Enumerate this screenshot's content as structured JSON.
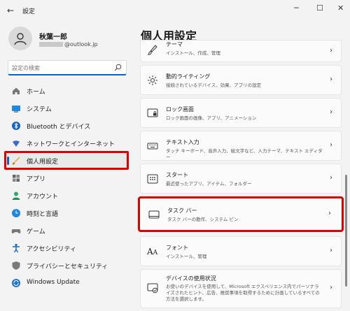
{
  "window": {
    "title": "設定",
    "back_icon": "back-arrow-icon",
    "minimize": "─",
    "maximize": "☐",
    "close": "✕"
  },
  "profile": {
    "name": "秋葉一郎",
    "email_suffix": "@outlook.jp"
  },
  "search": {
    "placeholder": "設定の検索"
  },
  "nav": [
    {
      "label": "ホーム",
      "icon": "home-icon"
    },
    {
      "label": "システム",
      "icon": "system-icon"
    },
    {
      "label": "Bluetooth とデバイス",
      "icon": "bluetooth-icon"
    },
    {
      "label": "ネットワークとインターネット",
      "icon": "network-icon"
    },
    {
      "label": "個人用設定",
      "icon": "personalization-icon",
      "active": true
    },
    {
      "label": "アプリ",
      "icon": "apps-icon"
    },
    {
      "label": "アカウント",
      "icon": "account-icon"
    },
    {
      "label": "時刻と言語",
      "icon": "time-language-icon"
    },
    {
      "label": "ゲーム",
      "icon": "gaming-icon"
    },
    {
      "label": "アクセシビリティ",
      "icon": "accessibility-icon"
    },
    {
      "label": "プライバシーとセキュリティ",
      "icon": "privacy-icon"
    },
    {
      "label": "Windows Update",
      "icon": "windows-update-icon"
    }
  ],
  "page": {
    "title": "個人用設定"
  },
  "cards": [
    {
      "title": "テーマ",
      "sub": "インストール、作成、管理",
      "icon": "theme-brush-icon"
    },
    {
      "title": "動的ライティング",
      "sub": "接続されているデバイス、効果、アプリの設定",
      "icon": "dynamic-lighting-icon"
    },
    {
      "title": "ロック画面",
      "sub": "ロック画面の画像、アプリ、アニメーション",
      "icon": "lock-screen-icon"
    },
    {
      "title": "テキスト入力",
      "sub": "タッチ キーボード、音声入力、絵文字など、入力テーマ、テキスト エディター",
      "icon": "keyboard-icon"
    },
    {
      "title": "スタート",
      "sub": "最近使ったアプリ、アイテム、フォルダー",
      "icon": "start-icon"
    },
    {
      "title": "タスク バー",
      "sub": "タスク バーの動作、システム ピン",
      "icon": "taskbar-icon",
      "selected": true
    },
    {
      "title": "フォント",
      "sub": "インストール、管理",
      "icon": "fonts-icon"
    },
    {
      "title": "デバイスの使用状況",
      "sub": "お使いのデバイスを使用して、Microsoft エクスペリエンス内でパーソナライズされたヒント、広告、推奨事項を取得するために計画しているすべての方法を選択します。",
      "icon": "device-usage-icon"
    }
  ],
  "colors": {
    "accent": "#0067c0",
    "highlight": "#e00000"
  }
}
